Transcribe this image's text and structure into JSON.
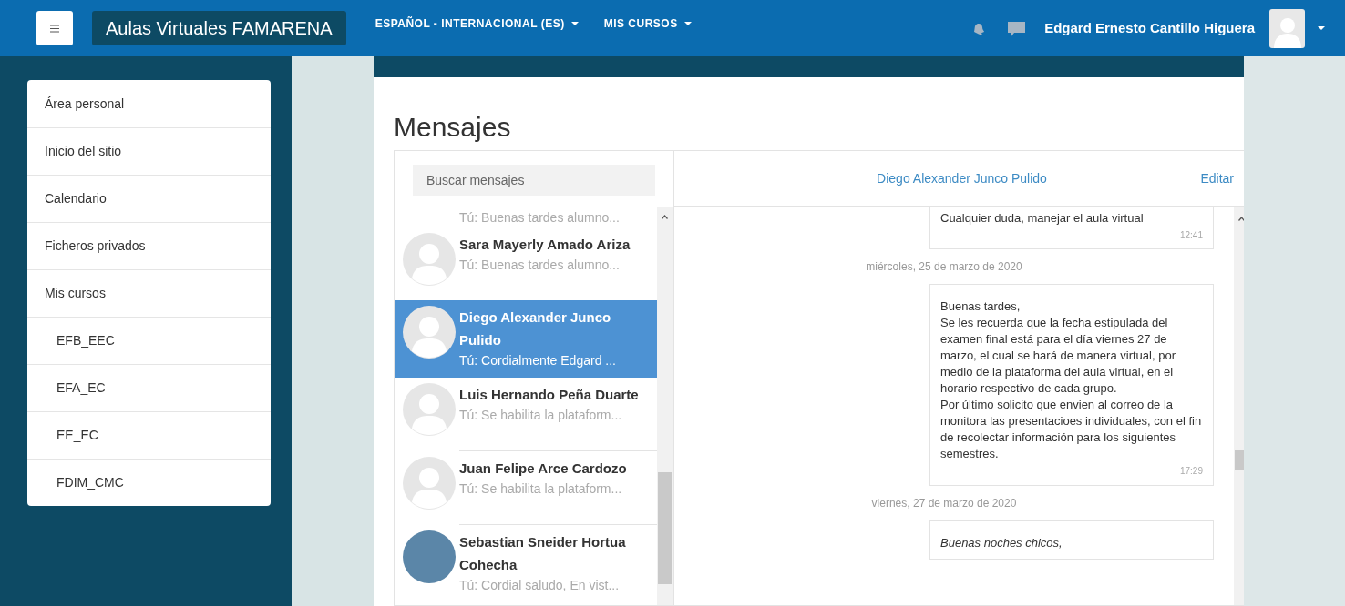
{
  "navbar": {
    "brand": "Aulas Virtuales FAMARENA",
    "menus": [
      {
        "label": "ESPAÑOL - INTERNACIONAL (ES)"
      },
      {
        "label": "MIS CURSOS"
      }
    ],
    "user_name": "Edgard Ernesto Cantillo Higuera"
  },
  "sidebar": {
    "items": [
      {
        "label": "Área personal"
      },
      {
        "label": "Inicio del sitio"
      },
      {
        "label": "Calendario"
      },
      {
        "label": "Ficheros privados"
      },
      {
        "label": "Mis cursos",
        "children": [
          {
            "label": "EFB_EEC"
          },
          {
            "label": "EFA_EC"
          },
          {
            "label": "EE_EC"
          },
          {
            "label": "FDIM_CMC"
          }
        ]
      }
    ]
  },
  "page_title": "Mensajes",
  "search": {
    "placeholder": "Buscar mensajes"
  },
  "conversations": [
    {
      "preview": "Tú: Buenas tardes alumno...",
      "selected": false
    },
    {
      "name": "Sara Mayerly Amado Ariza",
      "preview": "Tú: Buenas tardes alumno...",
      "photo": false,
      "selected": false
    },
    {
      "name": "Diego Alexander Junco Pulido",
      "preview": "Tú: Cordialmente Edgard ...",
      "photo": false,
      "selected": true
    },
    {
      "name": "Luis Hernando Peña Duarte",
      "preview": "Tú: Se habilita la plataform...",
      "photo": false,
      "selected": false
    },
    {
      "name": "Juan Felipe Arce Cardozo",
      "preview": "Tú: Se habilita la plataform...",
      "photo": false,
      "selected": false
    },
    {
      "name": "Sebastian Sneider Hortua Cohecha",
      "preview": "Tú: Cordial saludo, En vist...",
      "photo": true,
      "selected": false
    }
  ],
  "conversation": {
    "contact": "Diego Alexander Junco Pulido",
    "edit": "Editar",
    "items": [
      {
        "kind": "message",
        "text": "Cualquier duda, manejar el aula virtual",
        "time": "12:41",
        "italic": false
      },
      {
        "kind": "date",
        "text": "miércoles, 25 de marzo de 2020"
      },
      {
        "kind": "message",
        "text": "Buenas tardes,\nSe les recuerda que la fecha estipulada del examen final está para el día viernes 27 de marzo, el cual se hará de manera virtual, por medio de la plataforma del aula virtual, en el horario respectivo de cada grupo.\nPor último solicito que envien al correo de la monitora las presentacioes individuales, con el fin de recolectar información para los siguientes semestres.",
        "time": "17:29",
        "italic": false
      },
      {
        "kind": "date",
        "text": "viernes, 27 de marzo de 2020"
      },
      {
        "kind": "message",
        "text": "Buenas noches chicos,",
        "italic": true
      }
    ]
  }
}
